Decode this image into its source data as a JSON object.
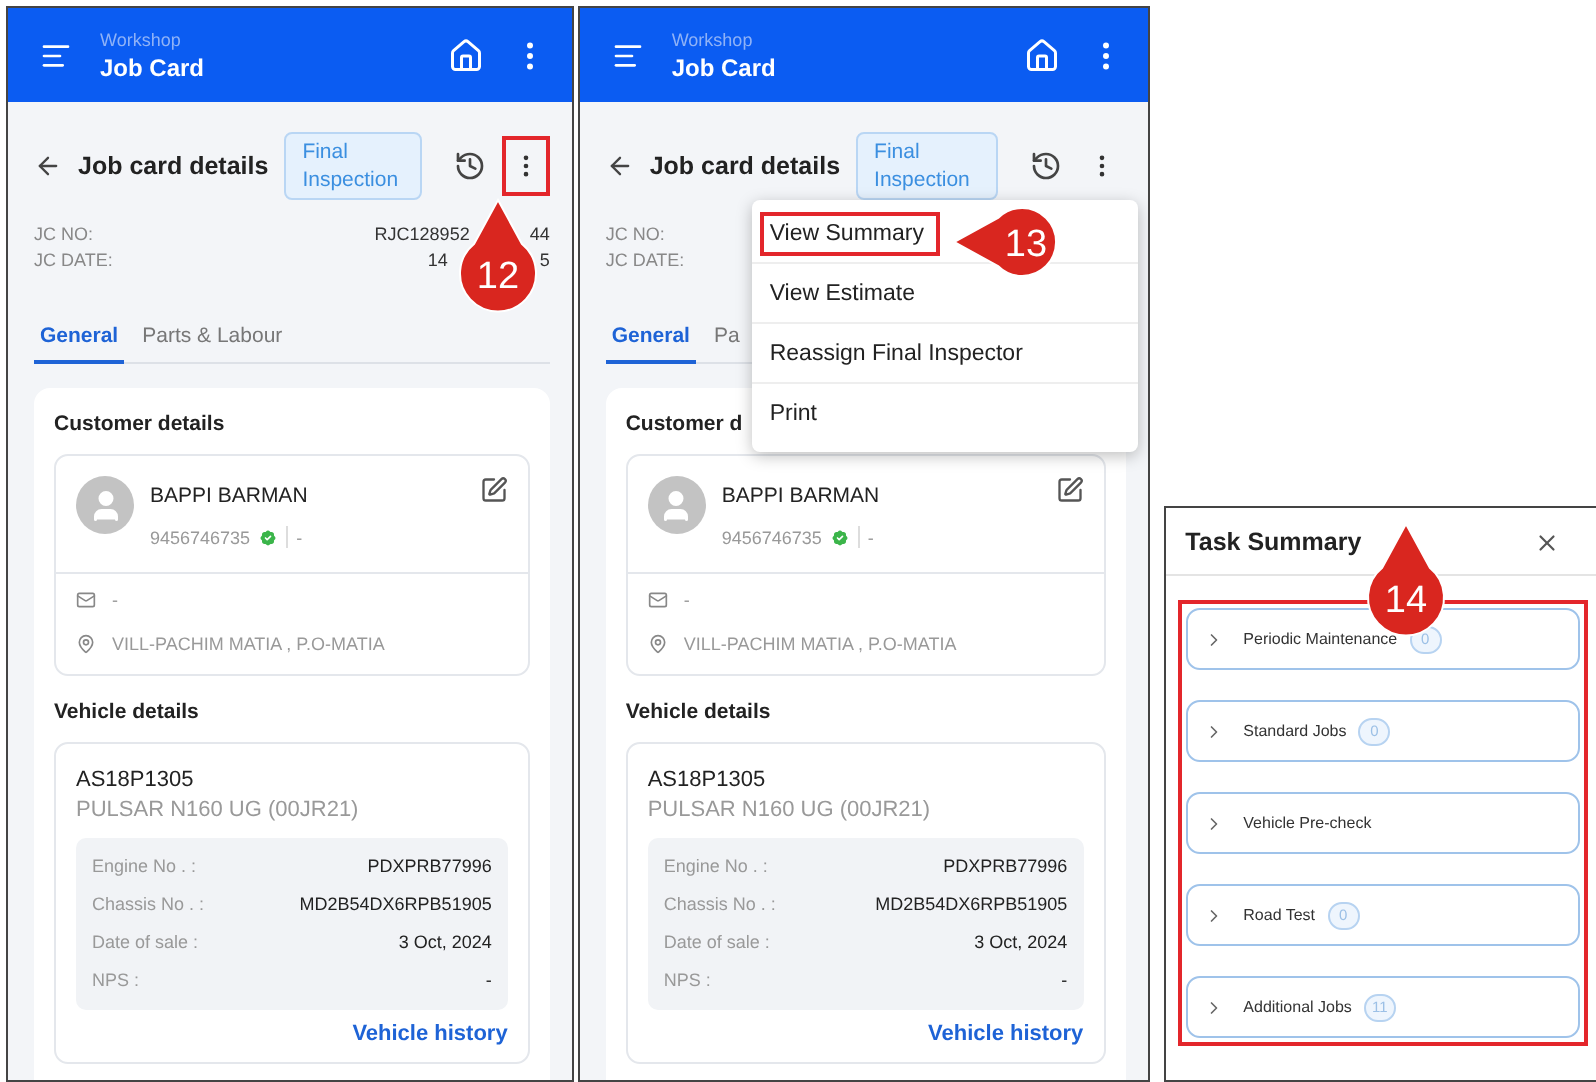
{
  "screens": [
    {
      "appbar": {
        "subtitle": "Workshop",
        "title": "Job Card"
      },
      "header": {
        "title": "Job card details",
        "status": "Final Inspection",
        "kebab_highlighted": true
      },
      "fields": [
        {
          "label": "JC NO:",
          "value_parts": [
            "RJC128952",
            "44"
          ]
        },
        {
          "label": "JC DATE:",
          "value_parts": [
            "14",
            "5"
          ]
        }
      ],
      "tabs": [
        {
          "label": "General",
          "selected": true
        },
        {
          "label": "Parts & Labour",
          "selected": false
        }
      ],
      "customer_heading": "Customer details",
      "customer": {
        "name": "BAPPI BARMAN",
        "phone": "9456746735",
        "verified": true,
        "alt_phone": "-",
        "email": "-",
        "address": "VILL-PACHIM MATIA , P.O-MATIA"
      },
      "vehicle_heading": "Vehicle details",
      "vehicle": {
        "plate": "AS18P1305",
        "model": "PULSAR N160 UG (00JR21)",
        "specs": [
          {
            "label": "Engine No . :",
            "value": "PDXPRB77996"
          },
          {
            "label": "Chassis No . :",
            "value": "MD2B54DX6RPB51905"
          },
          {
            "label": "Date of sale :",
            "value": "3 Oct, 2024"
          },
          {
            "label": "NPS :",
            "value": "-"
          }
        ],
        "link": "Vehicle history"
      },
      "annotation": {
        "kind": "pin",
        "number": "12"
      }
    },
    {
      "appbar": {
        "subtitle": "Workshop",
        "title": "Job Card"
      },
      "header": {
        "title": "Job card details",
        "status": "Final Inspection",
        "kebab_highlighted": false
      },
      "fields": [
        {
          "label": "JC NO:"
        },
        {
          "label": "JC DATE:"
        }
      ],
      "tabs": [
        {
          "label": "General",
          "selected": true
        },
        {
          "label": "Pa",
          "selected": false
        }
      ],
      "customer_heading": "Customer d",
      "customer": {
        "name": "BAPPI BARMAN",
        "phone": "9456746735",
        "verified": true,
        "alt_phone": "-",
        "email": "-",
        "address": "VILL-PACHIM MATIA , P.O-MATIA"
      },
      "vehicle_heading": "Vehicle details",
      "vehicle": {
        "plate": "AS18P1305",
        "model": "PULSAR N160 UG (00JR21)",
        "specs": [
          {
            "label": "Engine No . :",
            "value": "PDXPRB77996"
          },
          {
            "label": "Chassis No . :",
            "value": "MD2B54DX6RPB51905"
          },
          {
            "label": "Date of sale :",
            "value": "3 Oct, 2024"
          },
          {
            "label": "NPS :",
            "value": "-"
          }
        ],
        "link": "Vehicle history"
      },
      "menu": {
        "items": [
          {
            "label": "View Summary",
            "highlighted": true
          },
          {
            "label": "View Estimate",
            "highlighted": false
          },
          {
            "label": "Reassign Final Inspector",
            "highlighted": false
          },
          {
            "label": "Print",
            "highlighted": false
          }
        ]
      },
      "annotation": {
        "kind": "callout",
        "number": "13"
      }
    }
  ],
  "task_summary": {
    "title": "Task Summary",
    "annotation": {
      "kind": "pin",
      "number": "14"
    },
    "items": [
      {
        "label": "Periodic Maintenance",
        "count": "0",
        "expanded": false
      },
      {
        "label": "Standard Jobs",
        "count": "0",
        "expanded": false
      },
      {
        "label": "Vehicle Pre-check",
        "expanded": false
      },
      {
        "label": "Road Test",
        "count": "0",
        "expanded": false
      },
      {
        "label": "Additional Jobs",
        "count": "11",
        "expanded": false
      }
    ]
  }
}
